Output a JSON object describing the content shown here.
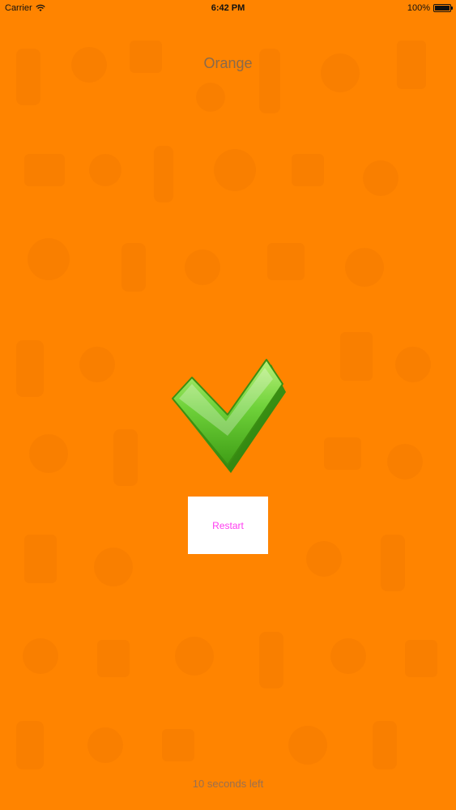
{
  "status_bar": {
    "carrier": "Carrier",
    "time": "6:42 PM",
    "battery": "100%",
    "battery_level": 1.0
  },
  "title": "Orange",
  "result_icon": "check-mark-icon",
  "restart_button": {
    "label": "Restart"
  },
  "timer_text": "10 seconds left",
  "colors": {
    "background": "#ff8400",
    "button_text": "#ff3cf0",
    "check_green": "#5ec72e"
  }
}
